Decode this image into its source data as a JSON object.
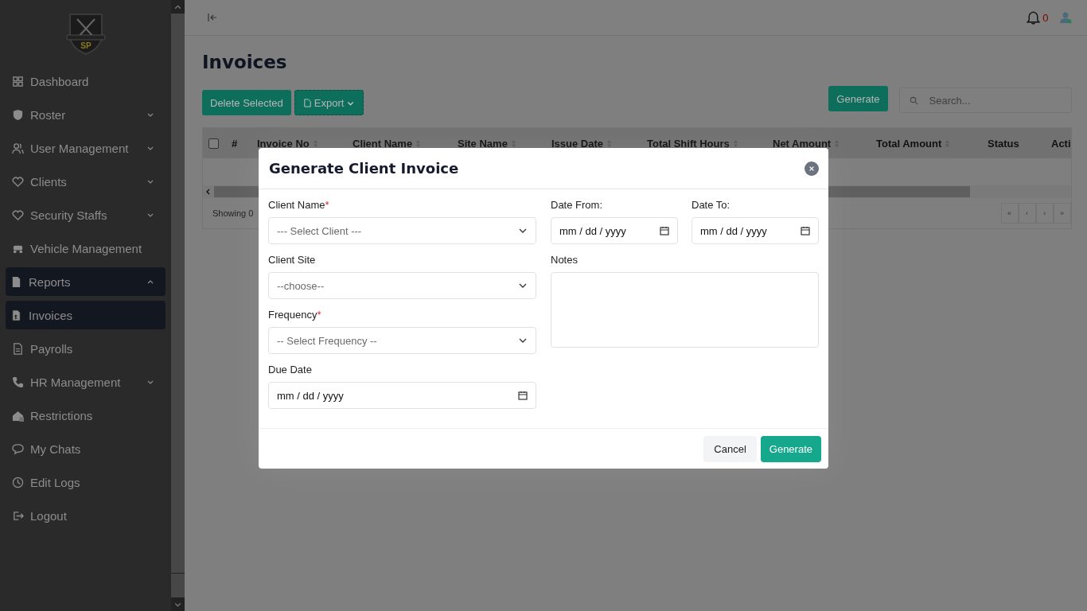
{
  "logo": {
    "text": "SP"
  },
  "sidebar": {
    "items": [
      {
        "label": "Dashboard",
        "selected": false
      },
      {
        "label": "Roster",
        "expanded": false,
        "selected": false
      },
      {
        "label": "User Management",
        "expanded": false,
        "selected": false
      },
      {
        "label": "Clients",
        "expanded": false,
        "selected": false
      },
      {
        "label": "Security Staffs",
        "expanded": false,
        "selected": false
      },
      {
        "label": "Vehicle Management",
        "selected": false
      },
      {
        "label": "Reports",
        "expanded": true,
        "selected": true,
        "children": [
          {
            "label": "Invoices",
            "selected": true
          },
          {
            "label": "Payrolls",
            "selected": false
          }
        ]
      },
      {
        "label": "HR Management",
        "expanded": false,
        "selected": false
      },
      {
        "label": "Restrictions",
        "selected": false
      },
      {
        "label": "My Chats",
        "selected": false
      },
      {
        "label": "Edit Logs",
        "selected": false
      },
      {
        "label": "Logout",
        "selected": false
      }
    ]
  },
  "topbar": {
    "notification_count": "0"
  },
  "page": {
    "title": "Invoices",
    "delete_button": "Delete Selected",
    "export_button": "Export",
    "generate_button": "Generate",
    "search": {
      "placeholder": "Search..."
    }
  },
  "table": {
    "select_all": {
      "checked": false
    },
    "columns": [
      {
        "label": "#",
        "sortable": false
      },
      {
        "label": "Invoice No",
        "sortable": true
      },
      {
        "label": "Client Name",
        "sortable": true
      },
      {
        "label": "Site Name",
        "sortable": true
      },
      {
        "label": "Issue Date",
        "sortable": true
      },
      {
        "label": "Total Shift Hours",
        "sortable": true
      },
      {
        "label": "Net Amount",
        "sortable": true
      },
      {
        "label": "Total Amount",
        "sortable": true
      },
      {
        "label": "Status",
        "sortable": false
      },
      {
        "label": "Acti",
        "sortable": false
      }
    ],
    "footer": "Showing 0",
    "pagination": [
      "«",
      "‹",
      "›",
      "»"
    ]
  },
  "modal": {
    "title": "Generate Client Invoice",
    "left_fields": [
      {
        "label": "Client Name",
        "required_mark": "*",
        "kind": "select",
        "placeholder": "--- Select Client ---"
      },
      {
        "label": "Client Site",
        "kind": "select",
        "placeholder": "--choose--"
      },
      {
        "label": "Frequency",
        "required_mark": "*",
        "kind": "select",
        "placeholder": "-- Select Frequency --"
      },
      {
        "label": "Due Date",
        "kind": "date",
        "value": "mm / dd / yyyy"
      }
    ],
    "date_fields": [
      {
        "label": "Date From:",
        "value": "mm / dd / yyyy"
      },
      {
        "label": "Date To:",
        "value": "mm / dd / yyyy"
      }
    ],
    "notes": {
      "label": "Notes"
    },
    "cancel_button": "Cancel",
    "submit_button": "Generate"
  }
}
